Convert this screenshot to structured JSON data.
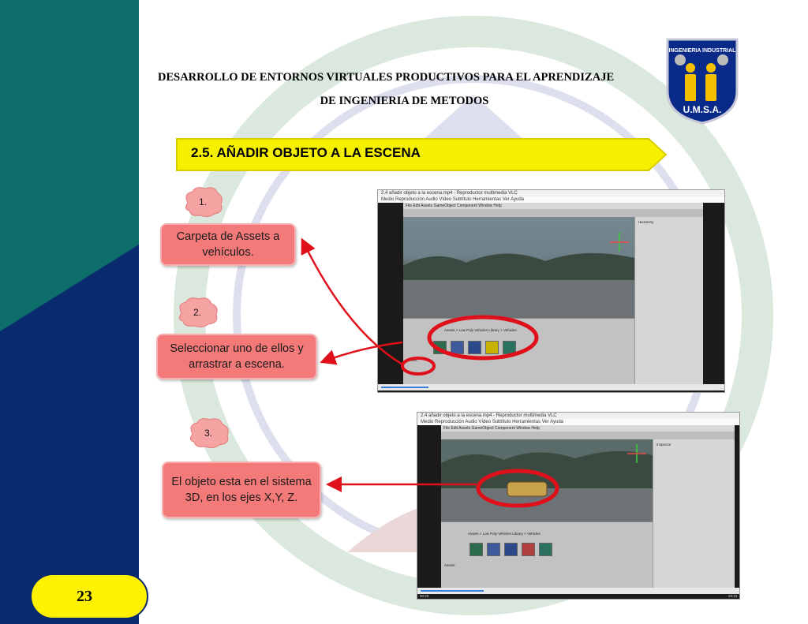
{
  "header": {
    "title": "DESARROLLO DE ENTORNOS VIRTUALES PRODUCTIVOS PARA EL APRENDIZAJE",
    "subtitle": "DE INGENIERIA DE METODOS",
    "logo_top_text": "INGENIERIA INDUSTRIAL",
    "logo_bottom_text": "U.M.S.A."
  },
  "section": {
    "heading": "2.5. AÑADIR OBJETO A LA ESCENA"
  },
  "steps": [
    {
      "number": "1.",
      "text": "Carpeta de Assets a vehículos."
    },
    {
      "number": "2.",
      "text": "Seleccionar uno de ellos y arrastrar a escena."
    },
    {
      "number": "3.",
      "text": "El objeto esta en el sistema 3D, en los ejes X,Y, Z."
    }
  ],
  "page": {
    "number": "23"
  },
  "screenshots": {
    "top_window_title": "2.4 añadir objeto a la escena.mp4 - Reproductor multimedia VLC",
    "bottom_window_title": "2.4 añadir objeto a la escena.mp4 - Reproductor multimedia VLC",
    "vlc_menu": "Medio  Reproducción  Audio  Vídeo  Subtítulo  Herramientas  Ver  Ayuda",
    "unity_menu": "File  Edit  Assets  GameObject  Component  Window  Help",
    "project_breadcrumb": "Assets > Low Poly Vehicles Library > Vehicles",
    "time_top_left": "00:20",
    "time_top_right": "03:23",
    "time_bottom_left": "00:28",
    "time_bottom_right": "03:23"
  },
  "colors": {
    "left_band_navy": "#0a2a6e",
    "left_band_teal": "#0d6e6b",
    "banner_yellow": "#f5f000",
    "callout_red": "#f47a7a",
    "highlight_red": "#e0101a",
    "page_badge_yellow": "#fff200"
  }
}
